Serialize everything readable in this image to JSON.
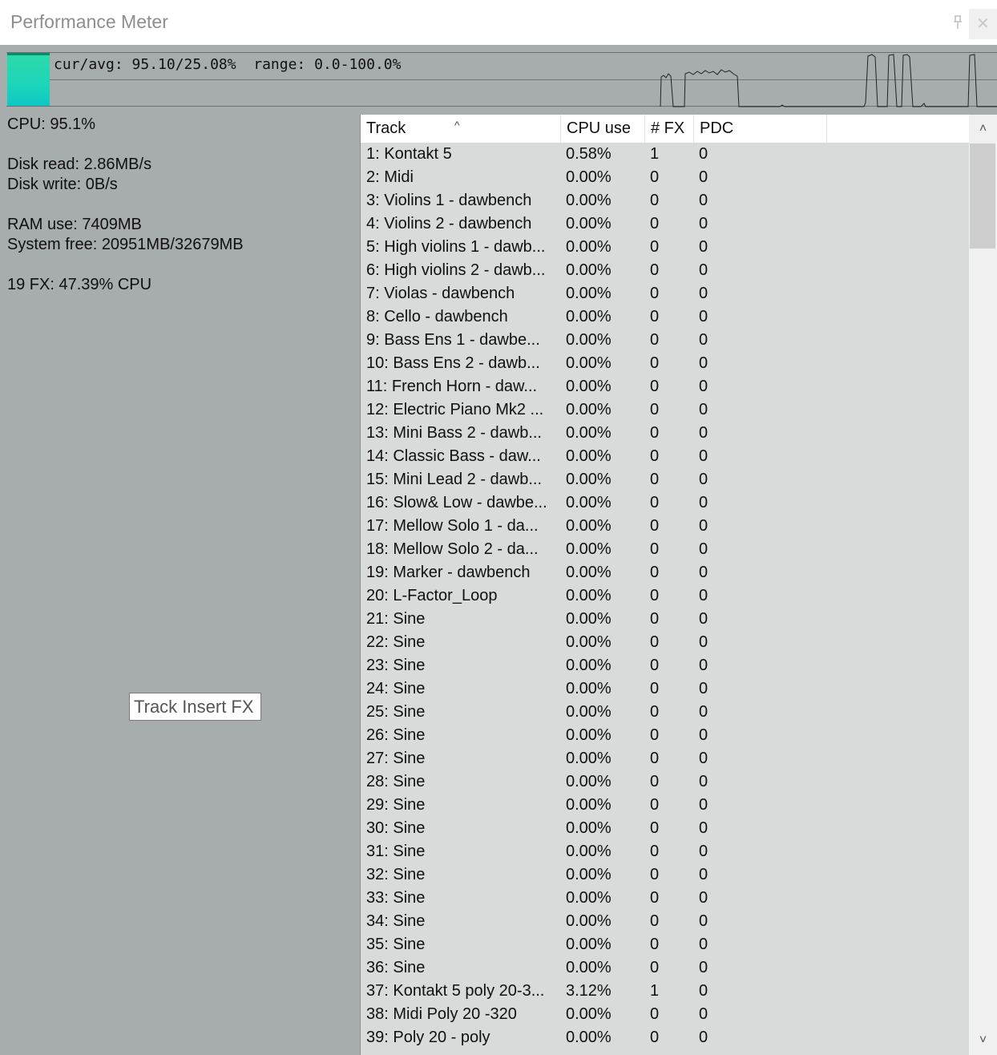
{
  "window": {
    "title": "Performance Meter",
    "pin_icon": "pin-icon",
    "close_glyph": "✕"
  },
  "meter": {
    "label": "cur/avg: 95.10/25.08%  range: 0.0-100.0%",
    "current_percent": 95.1,
    "fill_color": "#1dd5bb"
  },
  "stats": {
    "cpu": "CPU: 95.1%",
    "disk_read": "Disk read: 2.86MB/s",
    "disk_write": "Disk write: 0B/s",
    "ram_use": "RAM use: 7409MB",
    "system_free": "System free: 20951MB/32679MB",
    "fx_cpu": "19 FX: 47.39% CPU"
  },
  "tooltip": {
    "text": "Track Insert FX"
  },
  "table": {
    "columns": [
      "Track",
      "CPU use",
      "# FX",
      "PDC"
    ],
    "sort_glyph": "^",
    "rows": [
      [
        "1: Kontakt 5",
        "0.58%",
        "1",
        "0"
      ],
      [
        "2: Midi",
        "0.00%",
        "0",
        "0"
      ],
      [
        "3: Violins 1 - dawbench",
        "0.00%",
        "0",
        "0"
      ],
      [
        "4: Violins 2 - dawbench",
        "0.00%",
        "0",
        "0"
      ],
      [
        "5: High violins 1 - dawb...",
        "0.00%",
        "0",
        "0"
      ],
      [
        "6: High violins 2 - dawb...",
        "0.00%",
        "0",
        "0"
      ],
      [
        "7: Violas - dawbench",
        "0.00%",
        "0",
        "0"
      ],
      [
        "8: Cello - dawbench",
        "0.00%",
        "0",
        "0"
      ],
      [
        "9: Bass Ens 1 - dawbe...",
        "0.00%",
        "0",
        "0"
      ],
      [
        "10: Bass Ens 2 - dawb...",
        "0.00%",
        "0",
        "0"
      ],
      [
        "11: French Horn - daw...",
        "0.00%",
        "0",
        "0"
      ],
      [
        "12: Electric Piano Mk2 ...",
        "0.00%",
        "0",
        "0"
      ],
      [
        "13: Mini Bass 2 - dawb...",
        "0.00%",
        "0",
        "0"
      ],
      [
        "14: Classic Bass - daw...",
        "0.00%",
        "0",
        "0"
      ],
      [
        "15: Mini Lead 2 - dawb...",
        "0.00%",
        "0",
        "0"
      ],
      [
        "16: Slow& Low - dawbe...",
        "0.00%",
        "0",
        "0"
      ],
      [
        "17: Mellow Solo 1 - da...",
        "0.00%",
        "0",
        "0"
      ],
      [
        "18: Mellow Solo 2 - da...",
        "0.00%",
        "0",
        "0"
      ],
      [
        "19: Marker - dawbench",
        "0.00%",
        "0",
        "0"
      ],
      [
        "20: L-Factor_Loop",
        "0.00%",
        "0",
        "0"
      ],
      [
        "21: Sine",
        "0.00%",
        "0",
        "0"
      ],
      [
        "22: Sine",
        "0.00%",
        "0",
        "0"
      ],
      [
        "23: Sine",
        "0.00%",
        "0",
        "0"
      ],
      [
        "24: Sine",
        "0.00%",
        "0",
        "0"
      ],
      [
        "25: Sine",
        "0.00%",
        "0",
        "0"
      ],
      [
        "26: Sine",
        "0.00%",
        "0",
        "0"
      ],
      [
        "27: Sine",
        "0.00%",
        "0",
        "0"
      ],
      [
        "28: Sine",
        "0.00%",
        "0",
        "0"
      ],
      [
        "29: Sine",
        "0.00%",
        "0",
        "0"
      ],
      [
        "30: Sine",
        "0.00%",
        "0",
        "0"
      ],
      [
        "31: Sine",
        "0.00%",
        "0",
        "0"
      ],
      [
        "32: Sine",
        "0.00%",
        "0",
        "0"
      ],
      [
        "33: Sine",
        "0.00%",
        "0",
        "0"
      ],
      [
        "34: Sine",
        "0.00%",
        "0",
        "0"
      ],
      [
        "35: Sine",
        "0.00%",
        "0",
        "0"
      ],
      [
        "36: Sine",
        "0.00%",
        "0",
        "0"
      ],
      [
        "37: Kontakt 5 poly 20-3...",
        "3.12%",
        "1",
        "0"
      ],
      [
        "38: Midi Poly 20 -320",
        "0.00%",
        "0",
        "0"
      ],
      [
        "39: Poly 20 - poly",
        "0.00%",
        "0",
        "0"
      ]
    ]
  },
  "scrollbar": {
    "up_glyph": "˄",
    "down_glyph": "˅"
  }
}
